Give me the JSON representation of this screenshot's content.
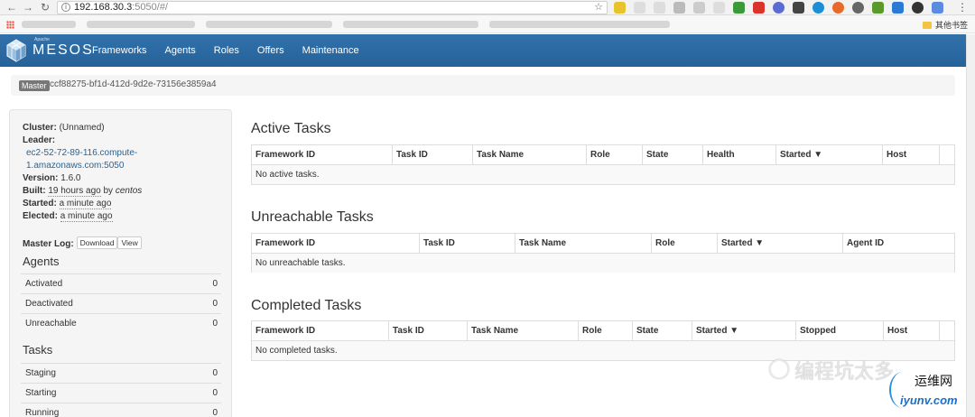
{
  "browser": {
    "url_host": "192.168.30.3",
    "url_path": ":5050/#/",
    "bookmark_folder": "其他书签"
  },
  "navbar": {
    "brand": "MESOS",
    "brand_prefix": "Apache",
    "links": [
      "Frameworks",
      "Agents",
      "Roles",
      "Offers",
      "Maintenance"
    ],
    "color": "#2e6da4"
  },
  "master": {
    "label": "Master",
    "id": "ccf88275-bf1d-412d-9d2e-73156e3859a4"
  },
  "sidebar": {
    "cluster_label": "Cluster:",
    "cluster_value": "(Unnamed)",
    "leader_label": "Leader:",
    "leader_line1": "ec2-52-72-89-116.compute-",
    "leader_line2": "1.amazonaws.com:5050",
    "version_label": "Version:",
    "version_value": "1.6.0",
    "built_label": "Built:",
    "built_value": "19 hours ago",
    "built_by": "by",
    "built_user": "centos",
    "started_label": "Started:",
    "started_value": "a minute ago",
    "elected_label": "Elected:",
    "elected_value": "a minute ago",
    "log_label": "Master Log:",
    "download_label": "Download",
    "view_label": "View",
    "agents_heading": "Agents",
    "agents": [
      {
        "label": "Activated",
        "value": "0"
      },
      {
        "label": "Deactivated",
        "value": "0"
      },
      {
        "label": "Unreachable",
        "value": "0"
      }
    ],
    "tasks_heading": "Tasks",
    "tasks": [
      {
        "label": "Staging",
        "value": "0"
      },
      {
        "label": "Starting",
        "value": "0"
      },
      {
        "label": "Running",
        "value": "0"
      }
    ]
  },
  "active": {
    "title": "Active Tasks",
    "columns": [
      "Framework ID",
      "Task ID",
      "Task Name",
      "Role",
      "State",
      "Health",
      "Started ▼",
      "Host"
    ],
    "empty": "No active tasks."
  },
  "unreachable": {
    "title": "Unreachable Tasks",
    "columns": [
      "Framework ID",
      "Task ID",
      "Task Name",
      "Role",
      "Started ▼",
      "Agent ID"
    ],
    "empty": "No unreachable tasks."
  },
  "completed": {
    "title": "Completed Tasks",
    "columns": [
      "Framework ID",
      "Task ID",
      "Task Name",
      "Role",
      "State",
      "Started ▼",
      "Stopped",
      "Host"
    ],
    "empty": "No completed tasks."
  },
  "watermark": {
    "text": "编程坑太多",
    "site_cn": "运维网",
    "site": "iyunv.com"
  }
}
